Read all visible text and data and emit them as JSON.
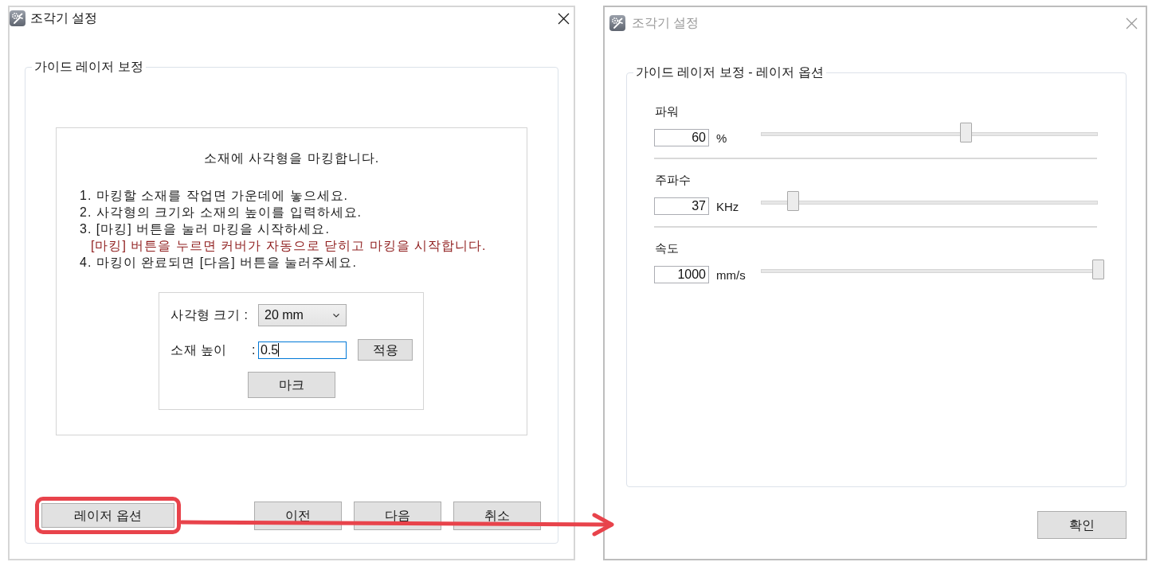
{
  "calibration_window": {
    "title": "조각기 설정",
    "active": true,
    "group_title": "가이드 레이저 보정",
    "heading": "소재에 사각형을 마킹합니다.",
    "steps": [
      {
        "kind": "step",
        "text": "1. 마킹할 소재를 작업면 가운데에 놓으세요."
      },
      {
        "kind": "step",
        "text": "2. 사각형의 크기와 소재의 높이를 입력하세요."
      },
      {
        "kind": "step",
        "text": "3. [마킹] 버튼을 눌러 마킹을 시작하세요."
      },
      {
        "kind": "note",
        "text": "[마킹] 버튼을 누르면 커버가 자동으로 닫히고 마킹을 시작합니다."
      },
      {
        "kind": "step",
        "text": "4. 마킹이 완료되면 [다음] 버튼을 눌러주세요."
      }
    ],
    "form": {
      "size_label": "사각형 크기 :",
      "size_value": "20 mm",
      "height_label": "소재 높이",
      "height_colon": ":",
      "height_value": "0.5",
      "height_focused": true,
      "apply_button": "적용",
      "mark_button": "마크"
    },
    "buttons": [
      {
        "label": "레이저 옵션",
        "highlighted": true
      },
      {
        "label": "이전",
        "highlighted": false
      },
      {
        "label": "다음",
        "highlighted": false
      },
      {
        "label": "취소",
        "highlighted": false
      }
    ]
  },
  "options_window": {
    "title": "조각기 설정",
    "active": false,
    "group_title": "가이드 레이저 보정 - 레이저 옵션",
    "settings": [
      {
        "label": "파워",
        "value": "60",
        "unit": "%",
        "level": 0.6
      },
      {
        "label": "주파수",
        "value": "37",
        "unit": "KHz",
        "level": 0.08
      },
      {
        "label": "속도",
        "value": "1000",
        "unit": "mm/s",
        "level": 1
      }
    ],
    "ok_button": "확인"
  }
}
